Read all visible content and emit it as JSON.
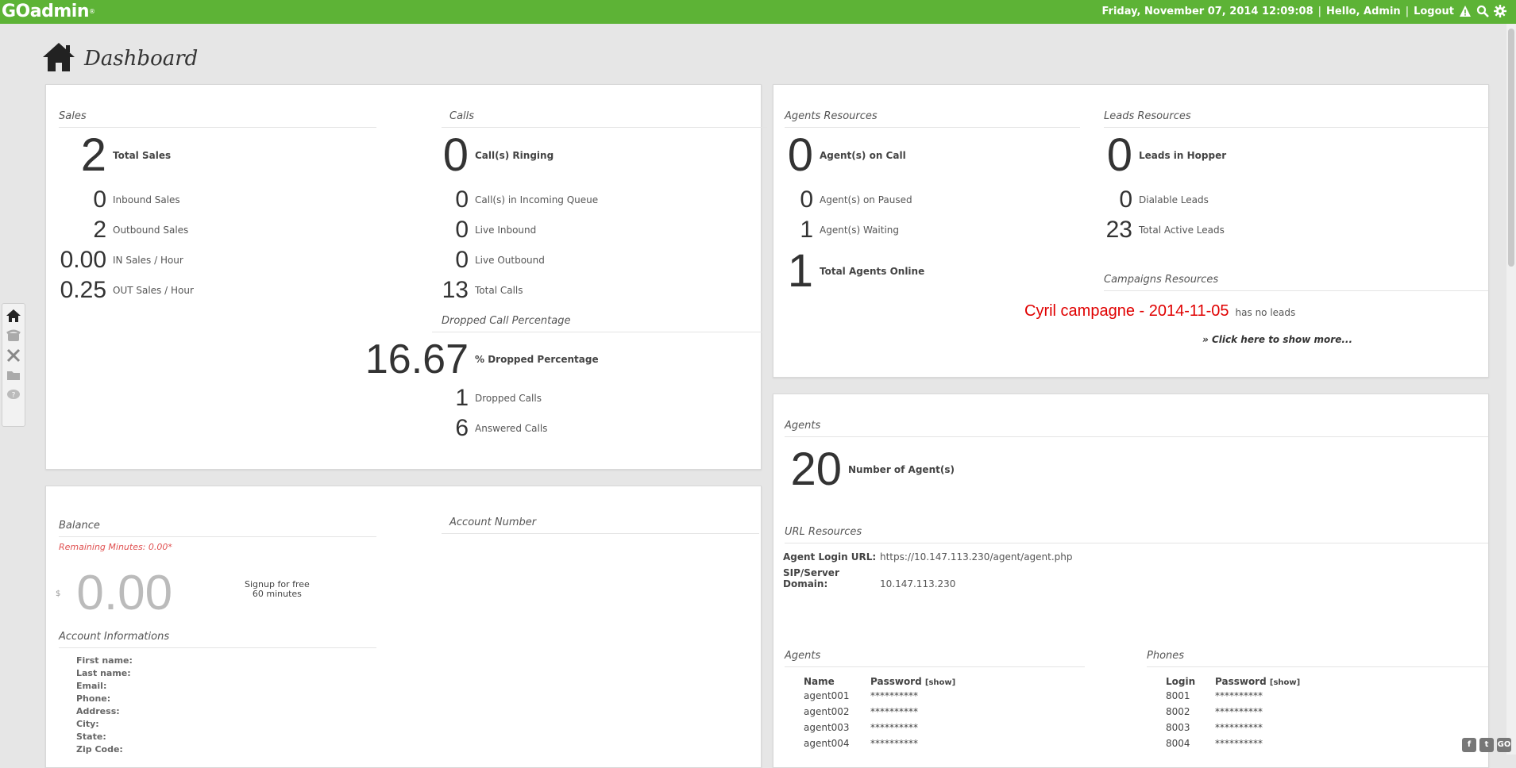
{
  "app": {
    "logo_main": "GOadmin",
    "logo_tm": "®"
  },
  "header": {
    "datetime": "Friday, November 07, 2014 12:09:08",
    "greeting": "Hello, Admin",
    "logout": "Logout",
    "separator": "|"
  },
  "page": {
    "title": "Dashboard"
  },
  "colors": {
    "topbar": "#5db336",
    "campaign": "#e00000",
    "remaining": "#e05050"
  },
  "rail": {
    "icons": [
      "home-icon",
      "phone-icon",
      "tools-icon",
      "folder-icon",
      "help-icon"
    ]
  },
  "sales": {
    "title": "Sales",
    "total_num": "2",
    "total_lbl": "Total Sales",
    "inbound_num": "0",
    "inbound_lbl": "Inbound Sales",
    "outbound_num": "2",
    "outbound_lbl": "Outbound Sales",
    "in_hour_num": "0.00",
    "in_hour_lbl": "IN Sales / Hour",
    "out_hour_num": "0.25",
    "out_hour_lbl": "OUT Sales / Hour"
  },
  "calls": {
    "title": "Calls",
    "ringing_num": "0",
    "ringing_lbl": "Call(s) Ringing",
    "queue_num": "0",
    "queue_lbl": "Call(s) in Incoming Queue",
    "live_in_num": "0",
    "live_in_lbl": "Live Inbound",
    "live_out_num": "0",
    "live_out_lbl": "Live Outbound",
    "total_num": "13",
    "total_lbl": "Total Calls"
  },
  "dropped": {
    "title": "Dropped Call Percentage",
    "pct_num": "16.67",
    "pct_lbl": "% Dropped Percentage",
    "dropped_num": "1",
    "dropped_lbl": "Dropped Calls",
    "answered_num": "6",
    "answered_lbl": "Answered Calls"
  },
  "agents_res": {
    "title": "Agents Resources",
    "on_call_num": "0",
    "on_call_lbl": "Agent(s) on Call",
    "paused_num": "0",
    "paused_lbl": "Agent(s) on Paused",
    "waiting_num": "1",
    "waiting_lbl": "Agent(s) Waiting",
    "online_num": "1",
    "online_lbl": "Total Agents Online"
  },
  "leads_res": {
    "title": "Leads Resources",
    "hopper_num": "0",
    "hopper_lbl": "Leads in Hopper",
    "dialable_num": "0",
    "dialable_lbl": "Dialable Leads",
    "active_num": "23",
    "active_lbl": "Total Active Leads"
  },
  "campaigns_res": {
    "title": "Campaigns Resources",
    "name": "Cyril campagne - 2014-11-05",
    "status": "has no leads",
    "more": "» Click here to show more..."
  },
  "agents": {
    "title": "Agents",
    "count_num": "20",
    "count_lbl": "Number of Agent(s)"
  },
  "url_res": {
    "title": "URL Resources",
    "login_key": "Agent Login URL:",
    "login_val": "https://10.147.113.230/agent/agent.php",
    "sip_key": "SIP/Server Domain:",
    "sip_val": "10.147.113.230"
  },
  "agents_table": {
    "title": "Agents",
    "col_name": "Name",
    "col_pass": "Password",
    "show": "[show]",
    "rows": [
      {
        "name": "agent001",
        "pass": "**********"
      },
      {
        "name": "agent002",
        "pass": "**********"
      },
      {
        "name": "agent003",
        "pass": "**********"
      },
      {
        "name": "agent004",
        "pass": "**********"
      }
    ]
  },
  "phones_table": {
    "title": "Phones",
    "col_login": "Login",
    "col_pass": "Password",
    "show": "[show]",
    "rows": [
      {
        "login": "8001",
        "pass": "**********"
      },
      {
        "login": "8002",
        "pass": "**********"
      },
      {
        "login": "8003",
        "pass": "**********"
      },
      {
        "login": "8004",
        "pass": "**********"
      }
    ]
  },
  "balance": {
    "title": "Balance",
    "remaining": "Remaining Minutes: 0.00*",
    "currency": "$",
    "amount": "0.00",
    "signup_line1": "Signup for free",
    "signup_line2": "60 minutes"
  },
  "account": {
    "number_title": "Account Number",
    "info_title": "Account Informations",
    "fields": [
      "First name:",
      "Last name:",
      "Email:",
      "Phone:",
      "Address:",
      "City:",
      "State:",
      "Zip Code:"
    ]
  },
  "social": {
    "facebook": "f",
    "twitter": "t",
    "go": "GO"
  }
}
